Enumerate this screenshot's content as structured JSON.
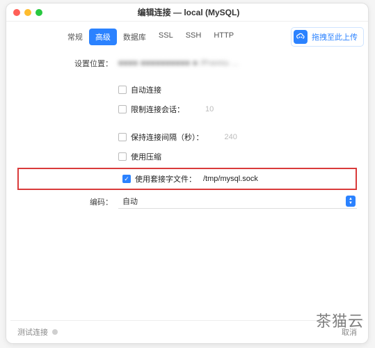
{
  "window": {
    "title": "编辑连接 — local (MySQL)"
  },
  "tabs": {
    "items": [
      {
        "label": "常规"
      },
      {
        "label": "高级"
      },
      {
        "label": "数据库"
      },
      {
        "label": "SSL"
      },
      {
        "label": "SSH"
      },
      {
        "label": "HTTP"
      }
    ],
    "active_index": 1
  },
  "upload": {
    "label": "拖拽至此上传"
  },
  "fields": {
    "location_label": "设置位置：",
    "location_value_masked": "■■■■ ■■■■■■■■■■ ■ /Premiu ...",
    "auto_connect": "自动连接",
    "limit_sessions": "限制连接会话：",
    "limit_sessions_value": "10",
    "keepalive": "保持连接间隔（秒）：",
    "keepalive_value": "240",
    "use_compression": "使用压缩",
    "use_socket": "使用套接字文件：",
    "socket_path": "/tmp/mysql.sock",
    "encoding_label": "编码：",
    "encoding_value": "自动"
  },
  "footer": {
    "test": "测试连接",
    "cancel": "取消"
  },
  "watermark": "茶猫云"
}
